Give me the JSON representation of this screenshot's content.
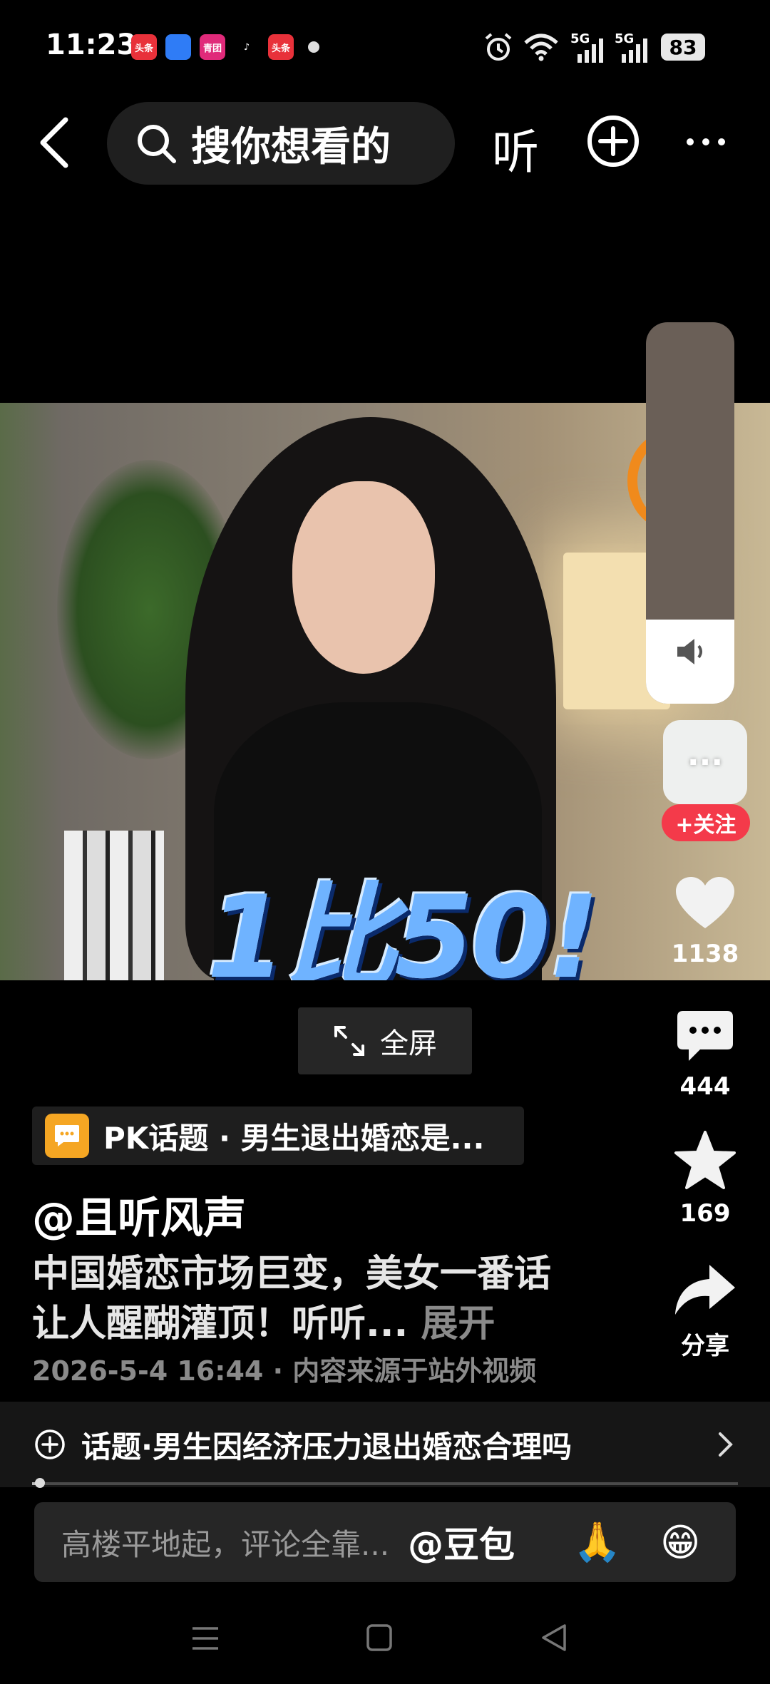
{
  "status_bar": {
    "time": "11:23",
    "apps": [
      {
        "label": "头条",
        "bg": "#e8313a",
        "fg": "#fff"
      },
      {
        "label": "",
        "bg": "#2f7cf6",
        "fg": "#fff"
      },
      {
        "label": "青团",
        "bg": "#e02a7a",
        "fg": "#fff"
      },
      {
        "label": "♪",
        "bg": "#000",
        "fg": "#fff"
      },
      {
        "label": "头条",
        "bg": "#e8313a",
        "fg": "#fff"
      }
    ],
    "network": [
      "5G",
      "5G"
    ],
    "battery": "83"
  },
  "top_nav": {
    "search_placeholder": "搜你想看的",
    "listen_label": "听"
  },
  "video": {
    "overlay_text": "1比50!",
    "volume_level": 0.22,
    "fullscreen_label": "全屏"
  },
  "side_rail": {
    "avatar_dots": "···",
    "follow_label": "+关注",
    "likes": "1138",
    "comments": "444",
    "favorites": "169",
    "share_label": "分享"
  },
  "meta": {
    "pk_topic": "PK话题 · 男生退出婚恋是...",
    "author": "@且听风声",
    "description": "中国婚恋市场巨变，美女一番话让人醒醐灌顶！听听...",
    "expand_label": "展开",
    "date_line": "2026-5-4 16:44 · 内容来源于站外视频"
  },
  "topic_bar": {
    "text": "话题·男生因经济压力退出婚恋合理吗"
  },
  "playback": {
    "progress": 0.011
  },
  "comment_bar": {
    "placeholder": "高楼平地起，评论全靠...",
    "mention": "@豆包",
    "emoji1": "🙏",
    "emoji2": "😁"
  },
  "colors": {
    "follow": "#f43a4a",
    "pk_icon": "#f5a623"
  }
}
